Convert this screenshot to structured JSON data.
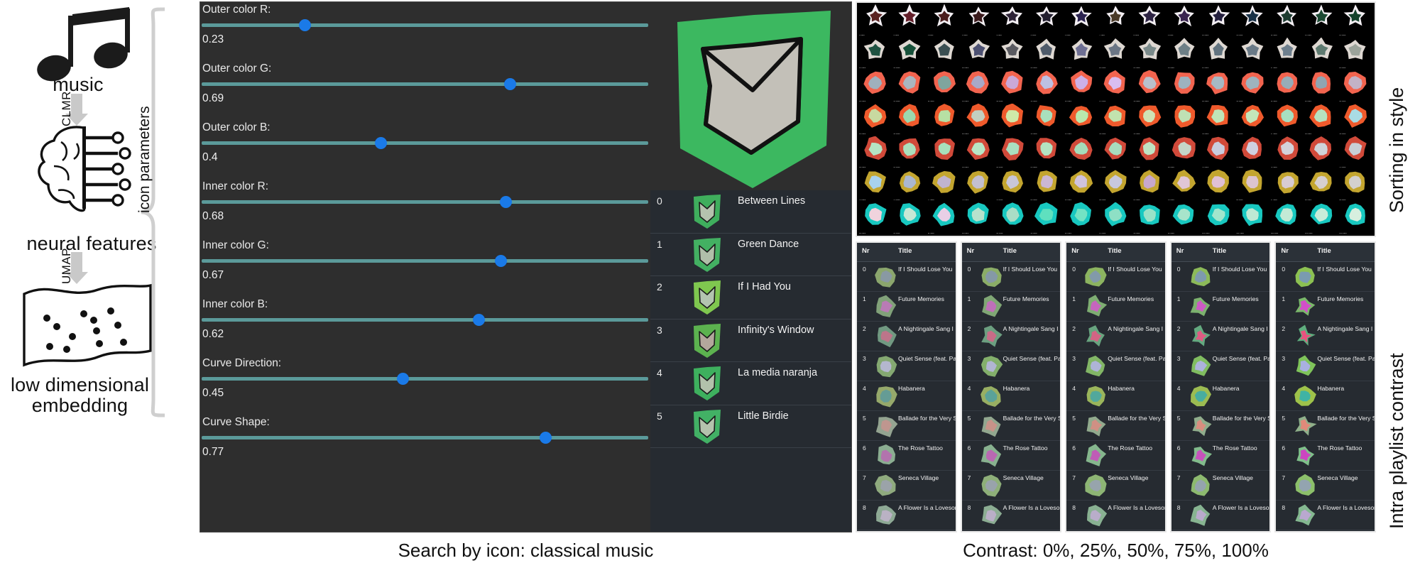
{
  "pipeline": {
    "music_label": "music",
    "neural_label": "neural features",
    "lowdim_label": "low dimensional\nembedding",
    "lowdim_line1": "low dimensional",
    "lowdim_line2": "embedding",
    "arrow1_label": "CLMR",
    "arrow2_label": "UMAP",
    "brace_label": "icon parameters"
  },
  "app": {
    "sliders": [
      {
        "label": "Outer color R:",
        "value": "0.23",
        "pct": 23
      },
      {
        "label": "Outer color G:",
        "value": "0.69",
        "pct": 69
      },
      {
        "label": "Outer color B:",
        "value": "0.4",
        "pct": 40
      },
      {
        "label": "Inner color R:",
        "value": "0.68",
        "pct": 68
      },
      {
        "label": "Inner color G:",
        "value": "0.67",
        "pct": 67
      },
      {
        "label": "Inner color B:",
        "value": "0.62",
        "pct": 62
      },
      {
        "label": "Curve Direction:",
        "value": "0.45",
        "pct": 45
      },
      {
        "label": "Curve Shape:",
        "value": "0.77",
        "pct": 77
      }
    ],
    "preview": {
      "outer_color": "#3cb860",
      "inner_color": "#c3c0b8",
      "stroke_color": "#111111"
    },
    "playlist": [
      {
        "nr": "0",
        "title": "Between Lines",
        "outer": "#3fae5d",
        "inner": "#b5c2ae"
      },
      {
        "nr": "1",
        "title": "Green Dance",
        "outer": "#43b062",
        "inner": "#b0bfa9"
      },
      {
        "nr": "2",
        "title": "If I Had You",
        "outer": "#7fc74f",
        "inner": "#b3c4b0"
      },
      {
        "nr": "3",
        "title": "Infinity's Window",
        "outer": "#5cb24f",
        "inner": "#b3a79c"
      },
      {
        "nr": "4",
        "title": "La media naranja",
        "outer": "#3eb05e",
        "inner": "#b2c1ab"
      },
      {
        "nr": "5",
        "title": "Little Birdie",
        "outer": "#42b165",
        "inner": "#b5c3ad"
      }
    ]
  },
  "right": {
    "sorting_label": "Sorting in style",
    "contrast_label": "Intra playlist contrast",
    "grid": {
      "cols": 15,
      "rows": 7,
      "row_styles": [
        {
          "outer": "#f2eef2",
          "inners": [
            "#5a2222",
            "#641f2a",
            "#4a1c1c",
            "#3a1a1c",
            "#2d2236",
            "#231f30",
            "#2b2350",
            "#4a3a28",
            "#2e2444",
            "#3a2450",
            "#241f3e",
            "#183046",
            "#1d3b30",
            "#1c4a33",
            "#14432c"
          ],
          "shape": "spike"
        },
        {
          "outer": "#ded8d2",
          "inners": [
            "#1f5241",
            "#17513a",
            "#3b4f52",
            "#4d5172",
            "#5a5a60",
            "#4f5b6a",
            "#6e6f93",
            "#6b7685",
            "#7a8a8a",
            "#6d7f86",
            "#62737f",
            "#6a7a87",
            "#6e7f8d",
            "#5e7a70",
            "#9ba39a"
          ],
          "shape": "star"
        },
        {
          "outer": "#f2644f",
          "inners": [
            "#9fb0bd",
            "#aab6c0",
            "#7fa59e",
            "#a8a9c7",
            "#caa8d8",
            "#bdc0e2",
            "#ccb1e8",
            "#d9bdf0",
            "#b9c0cc",
            "#9db2bf",
            "#a6b9c4",
            "#9db3bf",
            "#97adb9",
            "#8fa5b2",
            "#c3b2c6"
          ],
          "shape": "blob"
        },
        {
          "outer": "#ef5a2c",
          "inners": [
            "#c8d9a0",
            "#9bd9ae",
            "#b7e0a4",
            "#c2cfc0",
            "#cfe8a8",
            "#a9e0bd",
            "#b9e9ad",
            "#c2e3ae",
            "#cfe3b5",
            "#bfe0b4",
            "#bfe5b8",
            "#c3e7bb",
            "#a8dfc0",
            "#b6e3c0",
            "#a9dce4"
          ],
          "shape": "blob"
        },
        {
          "outer": "#d14a3a",
          "inners": [
            "#b5e4c4",
            "#abe0bd",
            "#a8e0bc",
            "#b8e6c6",
            "#aadfc0",
            "#b4e4c2",
            "#a5dcba",
            "#a8ddbe",
            "#bfe4c4",
            "#c5d6c8",
            "#c9cddf",
            "#cfd0e0",
            "#d4d2da",
            "#cfd4d9",
            "#c8cfd6"
          ],
          "shape": "blob"
        },
        {
          "outer": "#c3a52f",
          "inners": [
            "#a8d2ee",
            "#aab7d0",
            "#c0b4cf",
            "#c3bfd0",
            "#c8c6d8",
            "#cbb7d2",
            "#cfc3de",
            "#c8c8dd",
            "#c7a8cc",
            "#e0c6d7",
            "#e0c0d4",
            "#dcc4cf",
            "#d8ccd2",
            "#d6cfd0",
            "#d3d0cd"
          ],
          "shape": "blob"
        },
        {
          "outer": "#18c8c0",
          "inners": [
            "#f0d3dd",
            "#c6e8d5",
            "#e9cfe6",
            "#b8e2cd",
            "#a9ddc6",
            "#5fe0bf",
            "#73e3c4",
            "#8ee0c5",
            "#9ae2c8",
            "#a7e4cb",
            "#a0e6cd",
            "#bfe9d4",
            "#c2ead6",
            "#c8ecd9",
            "#d7efdf"
          ],
          "shape": "blob"
        }
      ],
      "caption_text": "track"
    },
    "contrast_panels": {
      "col_nr": "Nr",
      "col_title": "Title",
      "levels": [
        "0%",
        "25%",
        "50%",
        "75%",
        "100%"
      ],
      "rows": [
        {
          "nr": "0",
          "title": "If I Should Lose You"
        },
        {
          "nr": "1",
          "title": "Future Memories"
        },
        {
          "nr": "2",
          "title": "A Nightingale Sang I"
        },
        {
          "nr": "3",
          "title": "Quiet Sense (feat. Pa"
        },
        {
          "nr": "4",
          "title": "Habanera"
        },
        {
          "nr": "5",
          "title": "Ballade for the Very S"
        },
        {
          "nr": "6",
          "title": "The Rose Tattoo"
        },
        {
          "nr": "7",
          "title": "Seneca Village"
        },
        {
          "nr": "8",
          "title": "A Flower Is a Lovesor"
        }
      ],
      "row_colors": [
        {
          "outer": "#8cc152",
          "inner": "#7a9bb0",
          "spike": 0.1,
          "hue": 70
        },
        {
          "outer": "#7ab86a",
          "inner": "#d24fc8",
          "spike": 0.62,
          "hue": 120
        },
        {
          "outer": "#5fae7e",
          "inner": "#e8537f",
          "spike": 0.85,
          "hue": 150
        },
        {
          "outer": "#7fc45a",
          "inner": "#a9b0e0",
          "spike": 0.35,
          "hue": 95
        },
        {
          "outer": "#9ec24a",
          "inner": "#3fb3a4",
          "spike": 0.12,
          "hue": 75
        },
        {
          "outer": "#8fb08a",
          "inner": "#e08a7a",
          "spike": 0.7,
          "hue": 110
        },
        {
          "outer": "#7fc08a",
          "inner": "#cc46c0",
          "spike": 0.58,
          "hue": 130
        },
        {
          "outer": "#8cc06a",
          "inner": "#93a4b0",
          "spike": 0.08,
          "hue": 90
        },
        {
          "outer": "#84b890",
          "inner": "#b9a8cf",
          "spike": 0.45,
          "hue": 140
        }
      ],
      "contrast_factors": [
        0.0,
        0.25,
        0.5,
        0.75,
        1.0
      ]
    }
  },
  "captions": {
    "left": "Search by icon: classical music",
    "right": "Contrast: 0%, 25%, 50%, 75%, 100%"
  }
}
